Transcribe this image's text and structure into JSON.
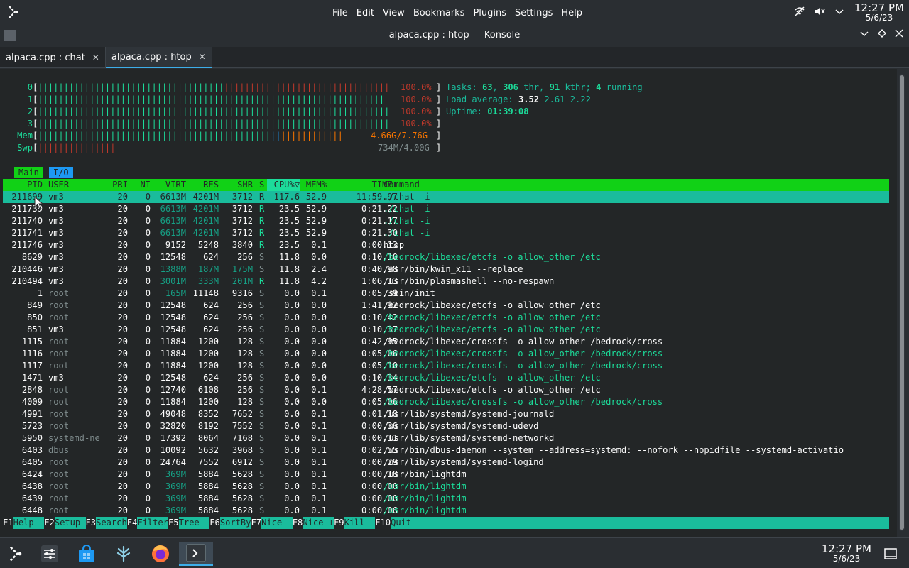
{
  "menubar": [
    "File",
    "Edit",
    "View",
    "Bookmarks",
    "Plugins",
    "Settings",
    "Help"
  ],
  "clock": {
    "time": "12:27 PM",
    "date": "5/6/23"
  },
  "window": {
    "title": "alpaca.cpp : htop — Konsole"
  },
  "tabs": [
    {
      "label": "alpaca.cpp : chat"
    },
    {
      "label": "alpaca.cpp : htop"
    }
  ],
  "meters": {
    "cpu": [
      {
        "label": "0",
        "g": "||||||||||||||||||||||||||||||||||||",
        "r": "||||||||||||||||||||||||||||||||",
        "val": "100.0%"
      },
      {
        "label": "1",
        "g": "|||||||||||||||||||||||||||||||||||||||||||||||||||||||||||||||||||",
        "r": "",
        "val": "100.0%"
      },
      {
        "label": "2",
        "g": "||||||||||||||||||||||||||||||||||||||||||||||||||||||||||||||||||||",
        "r": "",
        "val": "100.0%"
      },
      {
        "label": "3",
        "g": "||||||||||||||||||||||||||||||||||||||||||||||||||||||||||||||||||||",
        "r": "",
        "val": "100.0%"
      }
    ],
    "mem": {
      "label": "Mem",
      "g": "|||||||||||||||||||||||||||||||||||||||||||||",
      "b": "||",
      "o": "||||||||||||",
      "val": "4.66G/7.76G"
    },
    "swp": {
      "label": "Swp",
      "r": "|||||||||||||||",
      "val": "734M/4.00G"
    }
  },
  "summary": {
    "tasks_label": "Tasks: ",
    "tasks": "63",
    "thr": "306",
    "thr_label": " thr, ",
    "kthr": "91",
    "kthr_label": " kthr; ",
    "running": "4",
    "running_label": " running",
    "load_label": "Load average: ",
    "load1": "3.52",
    "load5": "2.61",
    "load15": "2.22",
    "uptime_label": "Uptime: ",
    "uptime": "01:39:08"
  },
  "modetabs": [
    "Main",
    "I/O"
  ],
  "columns": [
    "PID",
    "USER",
    "PRI",
    "NI",
    "VIRT",
    "RES",
    "SHR",
    "S",
    "CPU%▽",
    "MEM%",
    "TIME+",
    "Command"
  ],
  "processes": [
    [
      "211699",
      "vm3",
      "20",
      "0",
      "6613M",
      "4201M",
      "3712",
      "R",
      "117.6",
      "52.9",
      "11:59.97",
      "./chat -i"
    ],
    [
      "211739",
      "vm3",
      "20",
      "0",
      "6613M",
      "4201M",
      "3712",
      "R",
      "23.5",
      "52.9",
      "0:21.22",
      "./chat -i"
    ],
    [
      "211740",
      "vm3",
      "20",
      "0",
      "6613M",
      "4201M",
      "3712",
      "R",
      "23.5",
      "52.9",
      "0:21.17",
      "./chat -i"
    ],
    [
      "211741",
      "vm3",
      "20",
      "0",
      "6613M",
      "4201M",
      "3712",
      "R",
      "23.5",
      "52.9",
      "0:21.30",
      "./chat -i"
    ],
    [
      "211746",
      "vm3",
      "20",
      "0",
      "9152",
      "5248",
      "3840",
      "R",
      "23.5",
      "0.1",
      "0:00.13",
      "htop"
    ],
    [
      "8629",
      "vm3",
      "20",
      "0",
      "12548",
      "624",
      "256",
      "S",
      "11.8",
      "0.0",
      "0:10.10",
      "/bedrock/libexec/etcfs -o allow_other /etc"
    ],
    [
      "210446",
      "vm3",
      "20",
      "0",
      "1388M",
      "187M",
      "175M",
      "S",
      "11.8",
      "2.4",
      "0:40.98",
      "/usr/bin/kwin_x11 --replace"
    ],
    [
      "210494",
      "vm3",
      "20",
      "0",
      "3001M",
      "333M",
      "201M",
      "R",
      "11.8",
      "4.2",
      "1:06.13",
      "/usr/bin/plasmashell --no-respawn"
    ],
    [
      "1",
      "root",
      "20",
      "0",
      "165M",
      "11148",
      "9316",
      "S",
      "0.0",
      "0.1",
      "0:05.39",
      "/sbin/init"
    ],
    [
      "849",
      "root",
      "20",
      "0",
      "12548",
      "624",
      "256",
      "S",
      "0.0",
      "0.0",
      "1:41.92",
      "/bedrock/libexec/etcfs -o allow_other /etc"
    ],
    [
      "850",
      "root",
      "20",
      "0",
      "12548",
      "624",
      "256",
      "S",
      "0.0",
      "0.0",
      "0:10.42",
      "/bedrock/libexec/etcfs -o allow_other /etc"
    ],
    [
      "851",
      "vm3",
      "20",
      "0",
      "12548",
      "624",
      "256",
      "S",
      "0.0",
      "0.0",
      "0:10.37",
      "/bedrock/libexec/etcfs -o allow_other /etc"
    ],
    [
      "1115",
      "root",
      "20",
      "0",
      "11884",
      "1200",
      "128",
      "S",
      "0.0",
      "0.0",
      "0:42.95",
      "/bedrock/libexec/crossfs -o allow_other /bedrock/cross"
    ],
    [
      "1116",
      "root",
      "20",
      "0",
      "11884",
      "1200",
      "128",
      "S",
      "0.0",
      "0.0",
      "0:05.06",
      "/bedrock/libexec/crossfs -o allow_other /bedrock/cross"
    ],
    [
      "1117",
      "root",
      "20",
      "0",
      "11884",
      "1200",
      "128",
      "S",
      "0.0",
      "0.0",
      "0:05.10",
      "/bedrock/libexec/crossfs -o allow_other /bedrock/cross"
    ],
    [
      "1471",
      "vm3",
      "20",
      "0",
      "12548",
      "624",
      "256",
      "S",
      "0.0",
      "0.0",
      "0:10.34",
      "/bedrock/libexec/etcfs -o allow_other /etc"
    ],
    [
      "2848",
      "root",
      "20",
      "0",
      "12740",
      "6108",
      "256",
      "S",
      "0.0",
      "0.1",
      "4:28.57",
      "/bedrock/libexec/etcfs -o allow_other /etc"
    ],
    [
      "4009",
      "root",
      "20",
      "0",
      "11884",
      "1200",
      "128",
      "S",
      "0.0",
      "0.0",
      "0:05.06",
      "/bedrock/libexec/crossfs -o allow_other /bedrock/cross"
    ],
    [
      "4991",
      "root",
      "20",
      "0",
      "49048",
      "8352",
      "7652",
      "S",
      "0.0",
      "0.1",
      "0:01.18",
      "/usr/lib/systemd/systemd-journald"
    ],
    [
      "5723",
      "root",
      "20",
      "0",
      "32820",
      "8192",
      "7552",
      "S",
      "0.0",
      "0.1",
      "0:00.36",
      "/usr/lib/systemd/systemd-udevd"
    ],
    [
      "5950",
      "systemd-ne",
      "20",
      "0",
      "17392",
      "8064",
      "7168",
      "S",
      "0.0",
      "0.1",
      "0:00.11",
      "/usr/lib/systemd/systemd-networkd"
    ],
    [
      "6403",
      "dbus",
      "20",
      "0",
      "10092",
      "5632",
      "3968",
      "S",
      "0.0",
      "0.1",
      "0:02.55",
      "/usr/bin/dbus-daemon --system --address=systemd: --nofork --nopidfile --systemd-activatio"
    ],
    [
      "6405",
      "root",
      "20",
      "0",
      "24764",
      "7552",
      "6912",
      "S",
      "0.0",
      "0.1",
      "0:00.29",
      "/usr/lib/systemd/systemd-logind"
    ],
    [
      "6424",
      "root",
      "20",
      "0",
      "369M",
      "5884",
      "5628",
      "S",
      "0.0",
      "0.1",
      "0:00.18",
      "/usr/bin/lightdm"
    ],
    [
      "6438",
      "root",
      "20",
      "0",
      "369M",
      "5884",
      "5628",
      "S",
      "0.0",
      "0.1",
      "0:00.00",
      "/usr/bin/lightdm"
    ],
    [
      "6439",
      "root",
      "20",
      "0",
      "369M",
      "5884",
      "5628",
      "S",
      "0.0",
      "0.1",
      "0:00.00",
      "/usr/bin/lightdm"
    ],
    [
      "6448",
      "root",
      "20",
      "0",
      "369M",
      "5884",
      "5628",
      "S",
      "0.0",
      "0.1",
      "0:00.06",
      "/usr/bin/lightdm"
    ]
  ],
  "thread_rows": [
    1,
    2,
    3,
    5,
    10,
    11,
    13,
    14,
    15,
    17,
    24,
    25,
    26
  ],
  "fkeys": [
    {
      "key": "F1",
      "label": "Help  "
    },
    {
      "key": "F2",
      "label": "Setup "
    },
    {
      "key": "F3",
      "label": "Search"
    },
    {
      "key": "F4",
      "label": "Filter"
    },
    {
      "key": "F5",
      "label": "Tree  "
    },
    {
      "key": "F6",
      "label": "SortBy"
    },
    {
      "key": "F7",
      "label": "Nice -"
    },
    {
      "key": "F8",
      "label": "Nice +"
    },
    {
      "key": "F9",
      "label": "Kill  "
    },
    {
      "key": "F10",
      "label": "Quit"
    }
  ],
  "taskbar": [
    {
      "name": "application-launcher-icon"
    },
    {
      "name": "system-settings-icon"
    },
    {
      "name": "discover-store-icon"
    },
    {
      "name": "app-icon"
    },
    {
      "name": "firefox-icon"
    },
    {
      "name": "konsole-icon"
    }
  ]
}
